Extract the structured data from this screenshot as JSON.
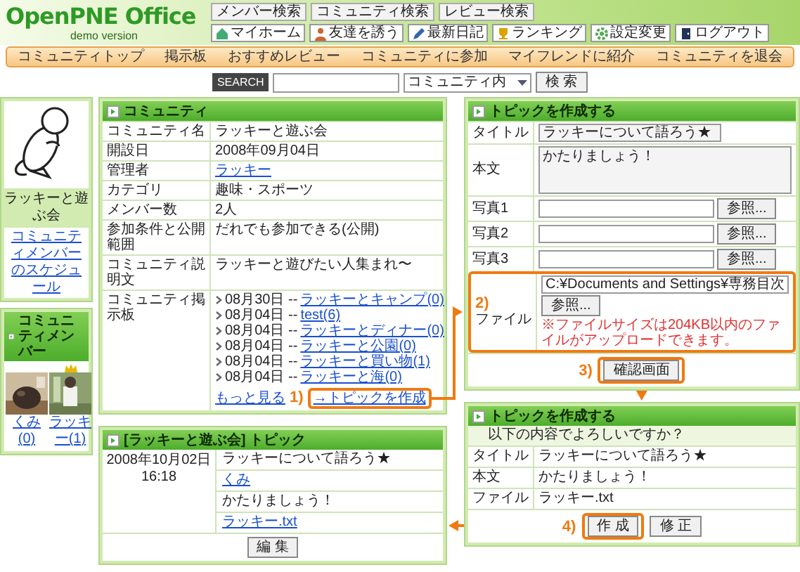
{
  "header": {
    "logo": "OpenPNE Office",
    "tagline": "demo version",
    "search_links": [
      "メンバー検索",
      "コミュニティ検索",
      "レビュー検索"
    ],
    "menu": [
      "マイホーム",
      "友達を誘う",
      "最新日記",
      "ランキング",
      "設定変更",
      "ログアウト"
    ]
  },
  "nav": [
    "コミュニティトップ",
    "掲示板",
    "おすすめレビュー",
    "コミュニティに参加",
    "マイフレンドに紹介",
    "コミュニティを退会"
  ],
  "search": {
    "label": "SEARCH",
    "scope": "コミュニティ内",
    "button": "検 索"
  },
  "community": {
    "name_caption": "ラッキーと遊ぶ会",
    "schedule_link": "コミュニティメンバーのスケジュール",
    "members_title": "コミュニティメンバー",
    "members": [
      {
        "name": "くみ(0)",
        "admin": false
      },
      {
        "name": "ラッキー(1)",
        "admin": true
      }
    ],
    "title": "コミュニティ",
    "rows": [
      {
        "label": "コミュニティ名",
        "value": "ラッキーと遊ぶ会",
        "kind": "text"
      },
      {
        "label": "開設日",
        "value": "2008年09月04日",
        "kind": "text"
      },
      {
        "label": "管理者",
        "value": "ラッキー",
        "kind": "link"
      },
      {
        "label": "カテゴリ",
        "value": "趣味・スポーツ",
        "kind": "text"
      },
      {
        "label": "メンバー数",
        "value": "2人",
        "kind": "text"
      },
      {
        "label": "参加条件と公開範囲",
        "value": "だれでも参加できる(公開)",
        "kind": "text"
      },
      {
        "label": "コミュニティ説明文",
        "value": "ラッキーと遊びたい人集まれ〜",
        "kind": "text"
      }
    ],
    "bbs": {
      "label": "コミュニティ掲示板",
      "topics": [
        {
          "date": "08月30日 --",
          "title": "ラッキーとキャンプ(0)"
        },
        {
          "date": "08月04日 --",
          "title": "test(6)"
        },
        {
          "date": "08月04日 --",
          "title": "ラッキーとディナー(0)"
        },
        {
          "date": "08月04日 --",
          "title": "ラッキーと公園(0)"
        },
        {
          "date": "08月04日 --",
          "title": "ラッキーと買い物(1)"
        },
        {
          "date": "08月04日 --",
          "title": "ラッキーと海(0)"
        }
      ],
      "more": "もっと見る",
      "step": "1)",
      "create_link": "→トピックを作成",
      "highlighted": true
    }
  },
  "topic_form": {
    "title": "トピックを作成する",
    "fields": [
      {
        "kind": "text",
        "label": "タイトル",
        "value": "ラッキーについて語ろう★"
      },
      {
        "kind": "textarea",
        "label": "本文",
        "value": "かたりましょう！"
      },
      {
        "kind": "file",
        "label": "写真1",
        "button": "参照..."
      },
      {
        "kind": "file",
        "label": "写真2",
        "button": "参照..."
      },
      {
        "kind": "file",
        "label": "写真3",
        "button": "参照..."
      },
      {
        "kind": "file",
        "label": "ファイル",
        "value": "C:¥Documents and Settings¥専務目次",
        "button": "参照...",
        "note": "※ファイルサイズは204KB以内のファイルがアップロードできます。",
        "highlighted": true,
        "step": "2)"
      }
    ],
    "submit": {
      "label": "確認画面",
      "step": "3)",
      "highlighted": true
    }
  },
  "confirm": {
    "title": "トピックを作成する",
    "question": "以下の内容でよろしいですか？",
    "rows": [
      {
        "label": "タイトル",
        "value": "ラッキーについて語ろう★"
      },
      {
        "label": "本文",
        "value": "かたりましょう！"
      },
      {
        "label": "ファイル",
        "value": "ラッキー.txt"
      }
    ],
    "buttons": [
      {
        "label": "作 成",
        "step": "4)",
        "highlighted": true
      },
      {
        "label": "修 正",
        "highlighted": false
      }
    ]
  },
  "result": {
    "title": "[ラッキーと遊ぶ会] トピック",
    "date": "2008年10月02日",
    "time": "16:18",
    "topic_title": "ラッキーについて語ろう★",
    "author": "くみ",
    "body": "かたりましょう！",
    "file": "ラッキー.txt",
    "button": "編 集"
  }
}
